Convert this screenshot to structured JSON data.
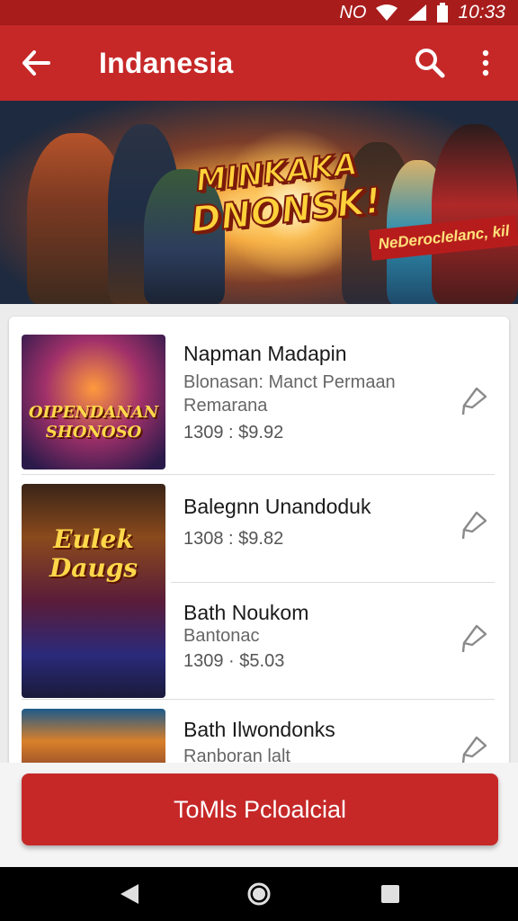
{
  "status_bar": {
    "carrier": "ΝO",
    "time": "10:33",
    "icons": [
      "wifi-icon",
      "signal-icon",
      "battery-icon"
    ]
  },
  "app_bar": {
    "title": "Indanesia",
    "icons": [
      "back-arrow-icon",
      "search-icon",
      "more-vert-icon"
    ]
  },
  "banner": {
    "title_line1": "MINKAKA",
    "title_line2": "DNONSK!",
    "tag": "NeDeroclelanc, kil"
  },
  "items": [
    {
      "title": "Napman Madapin",
      "subtitle_line1": "Blonasan: Manct Permaan",
      "subtitle_line2": "Remarana",
      "price": "1309 : $9.92",
      "thumb_text": "OIPENDANAN SHONOSO",
      "icon": "bookmark-icon"
    },
    {
      "title": "Balegnn Unandoduk",
      "subtitle_line1": "",
      "subtitle_line2": "",
      "price": "1308 : $9.82",
      "thumb_text": "Eulek Daugs",
      "icon": "bookmark-icon"
    },
    {
      "title": "Bath Noukom",
      "subtitle_line1": "Bantonac",
      "subtitle_line2": "",
      "price": "1309 · $5.03",
      "thumb_text": "",
      "icon": "bookmark-icon"
    },
    {
      "title": "Bath Ilwondonks",
      "subtitle_line1": "Ranboran lalt",
      "subtitle_line2": "",
      "price": "",
      "thumb_text": "",
      "icon": "bookmark-icon"
    }
  ],
  "cta": {
    "label": "ToMls Pcloalcial"
  },
  "colors": {
    "primary": "#c62828",
    "status_bar": "#a81c1c",
    "banner_tag": "#b71c1c"
  },
  "nav_bar": {
    "icons": [
      "back-triangle-icon",
      "home-circle-icon",
      "recents-square-icon"
    ]
  }
}
